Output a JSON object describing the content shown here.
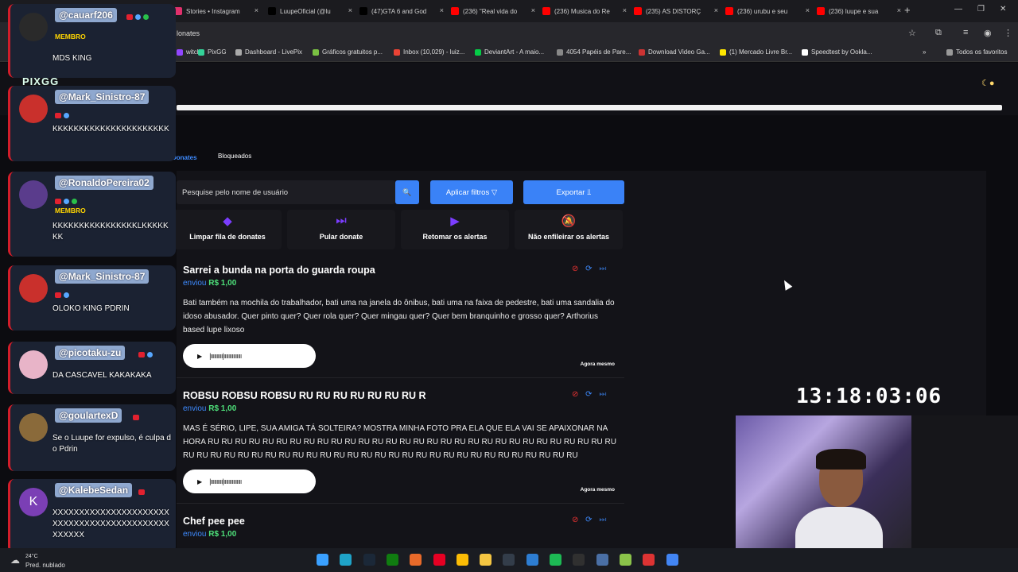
{
  "browser": {
    "tabs": [
      {
        "label": "Stories • Instagram",
        "color": "#e1306c"
      },
      {
        "label": "LuupeOficial (@lu",
        "color": "#000000"
      },
      {
        "label": "(47)GTA 6 and God",
        "color": "#000000"
      },
      {
        "label": "(236) \"Real vida do",
        "color": "#ff0000"
      },
      {
        "label": "(236) Musica do Re",
        "color": "#ff0000"
      },
      {
        "label": "(235) AS DISTORÇ",
        "color": "#ff0000"
      },
      {
        "label": "(236) urubu e seu",
        "color": "#ff0000"
      },
      {
        "label": "(236) luupe e sua",
        "color": "#ff0000"
      }
    ],
    "close_glyph": "×",
    "new_tab_glyph": "+",
    "window_controls": [
      "—",
      "❐",
      "✕"
    ],
    "url": "lonates",
    "bookmarks": [
      {
        "label": "witch",
        "color": "#9146ff"
      },
      {
        "label": "PixGG",
        "color": "#34d399"
      },
      {
        "label": "Dashboard - LivePix",
        "color": "#aaaaaa"
      },
      {
        "label": "Gráficos gratuitos p...",
        "color": "#7ac143"
      },
      {
        "label": "Inbox (10,029) - luiz...",
        "color": "#ea4335"
      },
      {
        "label": "DeviantArt - A maio...",
        "color": "#05cc47"
      },
      {
        "label": "4054 Papéis de Pare...",
        "color": "#888888"
      },
      {
        "label": "Download Video Ga...",
        "color": "#cc3333"
      },
      {
        "label": "(1) Mercado Livre Br...",
        "color": "#ffe600"
      },
      {
        "label": "Speedtest by Ookla...",
        "color": "#ffffff"
      }
    ],
    "bookmarks_more": "»",
    "all_favorites": "Todos os favoritos"
  },
  "app": {
    "logo": "PIXGG",
    "tabs": {
      "donates": "Donates",
      "blocked": "Bloqueados"
    },
    "search_placeholder": "Pesquise pelo nome de usuário",
    "search_glyph": "🔍",
    "apply_filters": "Aplicar filtros  ▽",
    "export": "Exportar  ⫫",
    "actions": [
      {
        "label": "Limpar fila de donates",
        "icon": "eraser-icon",
        "glyph": "◆"
      },
      {
        "label": "Pular donate",
        "icon": "skip-icon",
        "glyph": "⏭"
      },
      {
        "label": "Retomar os alertas",
        "icon": "play-icon",
        "glyph": "▶"
      },
      {
        "label": "Não enfileirar os alertas",
        "icon": "bell-off-icon",
        "glyph": "🔕"
      }
    ],
    "card_icons": {
      "block": "⊘",
      "replay": "⟳",
      "skip": "⏭"
    },
    "donations": [
      {
        "title": "Sarrei a bunda na porta do guarda roupa",
        "sent_label": "enviou",
        "amount": "R$ 1,00",
        "message": "Bati também na mochila do trabalhador, bati uma na janela do ônibus, bati uma na faixa de pedestre, bati uma sandalia do idoso abusador. Quer pinto quer? Quer rola quer? Quer mingau quer? Quer bem branquinho e grosso quer? Arthorius based lupe lixoso",
        "time": "Agora mesmo"
      },
      {
        "title": "ROBSU ROBSU ROBSU RU RU RU RU RU RU RU R",
        "sent_label": "enviou",
        "amount": "R$ 1,00",
        "message": "MAS É SÉRIO, LIPE, SUA AMIGA TÁ SOLTEIRA? MOSTRA MINHA FOTO PRA ELA QUE ELA VAI SE APAIXONAR NA HORA RU RU RU RU RU RU RU RU RU RU RU RU RU RU RU RU RU RU RU RU RU RU RU RU RU RU RU RU RU RU RU RU RU RU RU RU RU RU RU RU RU RU RU RU RU RU RU RU RU RU RU RU RU RU RU RU RU RU RU",
        "time": "Agora mesmo"
      },
      {
        "title": "Chef pee pee",
        "sent_label": "enviou",
        "amount": "R$ 1,00",
        "message": "",
        "time": ""
      }
    ],
    "audio": {
      "play_glyph": "▶",
      "wave": "|ıııııııııı|ııııııııııııııı"
    }
  },
  "overlay": {
    "clock": "13:18:03:06",
    "chat": [
      {
        "user": "@cauarf206",
        "badges": [
          "yt",
          "bl",
          "gr"
        ],
        "member": "MEMBRO",
        "text": "MDS KING",
        "avatar_color": "#2a2a2a",
        "avatar_glyph": ""
      },
      {
        "user": "@Mark_Sinistro-87",
        "badges": [
          "yt",
          "bl"
        ],
        "member": "",
        "text": "KKKKKKKKKKKKKKKKKKKKKK",
        "avatar_color": "#c9302c",
        "avatar_glyph": ""
      },
      {
        "user": "@RonaldoPereira02",
        "badges": [
          "yt",
          "bl",
          "gr"
        ],
        "member": "MEMBRO",
        "text": "KKKKKKKKKKKKKKKKLKKKKKKK",
        "avatar_color": "#5a3c8c",
        "avatar_glyph": ""
      },
      {
        "user": "@Mark_Sinistro-87",
        "badges": [
          "yt",
          "bl"
        ],
        "member": "",
        "text": "OLOKO KING PDRIN",
        "avatar_color": "#c9302c",
        "avatar_glyph": ""
      },
      {
        "user": "@picotaku-zu",
        "badges": [
          "yt",
          "bl"
        ],
        "member": "",
        "text": "DA CASCAVEL KAKAKAKA",
        "avatar_color": "#e8b4c8",
        "avatar_glyph": ""
      },
      {
        "user": "@goulartexD",
        "badges": [
          "yt"
        ],
        "member": "",
        "text": "Se o Luupe for expulso, é culpa do Pdrin",
        "avatar_color": "#8a6a3a",
        "avatar_glyph": ""
      },
      {
        "user": "@KalebeSedan",
        "badges": [
          "yt"
        ],
        "member": "",
        "text": "XXXXXXXXXXXXXXXXXXXXXXXXXXXXXXXXXXXXXXXXXXXXXXXXXX",
        "avatar_color": "#7b3fb5",
        "avatar_glyph": "K"
      }
    ]
  },
  "taskbar": {
    "weather_temp": "24°C",
    "weather_desc": "Pred. nublado",
    "icons": [
      {
        "name": "start-icon",
        "color": "#3aa0ff"
      },
      {
        "name": "edge-icon",
        "color": "#1fa3c8"
      },
      {
        "name": "steam-icon",
        "color": "#1b2838"
      },
      {
        "name": "xbox-icon",
        "color": "#107c10"
      },
      {
        "name": "app-icon",
        "color": "#e86a2a"
      },
      {
        "name": "pinterest-icon",
        "color": "#e60023"
      },
      {
        "name": "chrome-icon",
        "color": "#fbbc05"
      },
      {
        "name": "explorer-icon",
        "color": "#f4c542"
      },
      {
        "name": "terminal-icon",
        "color": "#333d4a"
      },
      {
        "name": "notes-icon",
        "color": "#2d7dd2"
      },
      {
        "name": "spotify-icon",
        "color": "#1db954"
      },
      {
        "name": "obs-icon",
        "color": "#303030"
      },
      {
        "name": "calc-icon",
        "color": "#4a6fa5"
      },
      {
        "name": "game-icon",
        "color": "#8bc34a"
      },
      {
        "name": "app2-icon",
        "color": "#d33"
      },
      {
        "name": "chrome2-icon",
        "color": "#4285f4"
      }
    ]
  },
  "colors": {
    "accent": "#3a82f7",
    "purple": "#7b3dff",
    "amount": "#4ee07a"
  }
}
